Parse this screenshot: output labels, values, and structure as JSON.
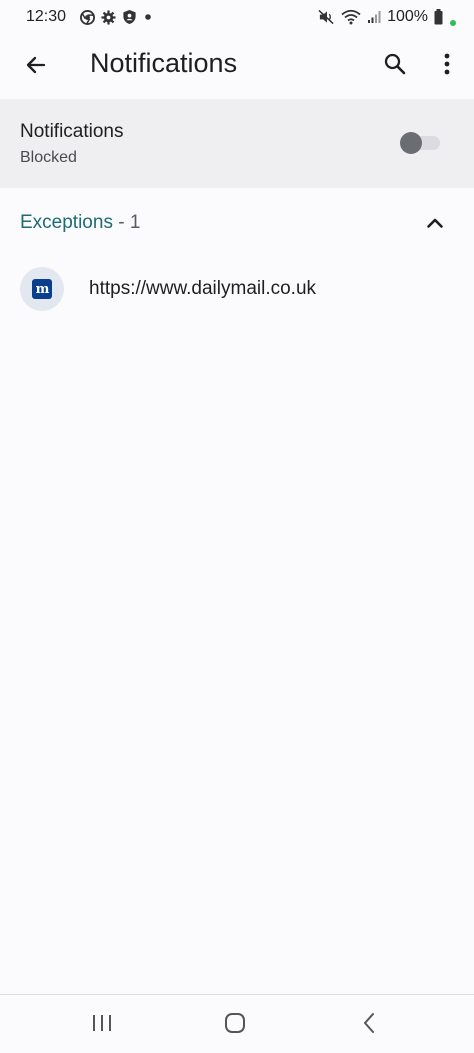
{
  "status_bar": {
    "time": "12:30",
    "battery_percent": "100%",
    "left_icons": [
      "chrome-icon",
      "gear-icon",
      "shield-icon",
      "dot-icon"
    ],
    "right_icons": [
      "mute-icon",
      "wifi-icon",
      "signal-icon",
      "battery-icon"
    ]
  },
  "app_bar": {
    "title": "Notifications",
    "icons": [
      "back-arrow-icon",
      "search-icon",
      "more-vertical-icon"
    ]
  },
  "notifications_toggle": {
    "title": "Notifications",
    "subtitle": "Blocked",
    "enabled": false
  },
  "exceptions": {
    "title": "Exceptions",
    "count": " - 1",
    "expanded": true,
    "sites": [
      {
        "url": "https://www.dailymail.co.uk",
        "favicon": "dailymail-favicon-icon"
      }
    ]
  },
  "nav_bar": {
    "icons": [
      "recents-icon",
      "home-icon",
      "back-icon"
    ]
  },
  "colors": {
    "accent": "#1e6b73",
    "toggle_row_bg": "#efeff2",
    "favicon_bg": "#0a3f8f"
  }
}
